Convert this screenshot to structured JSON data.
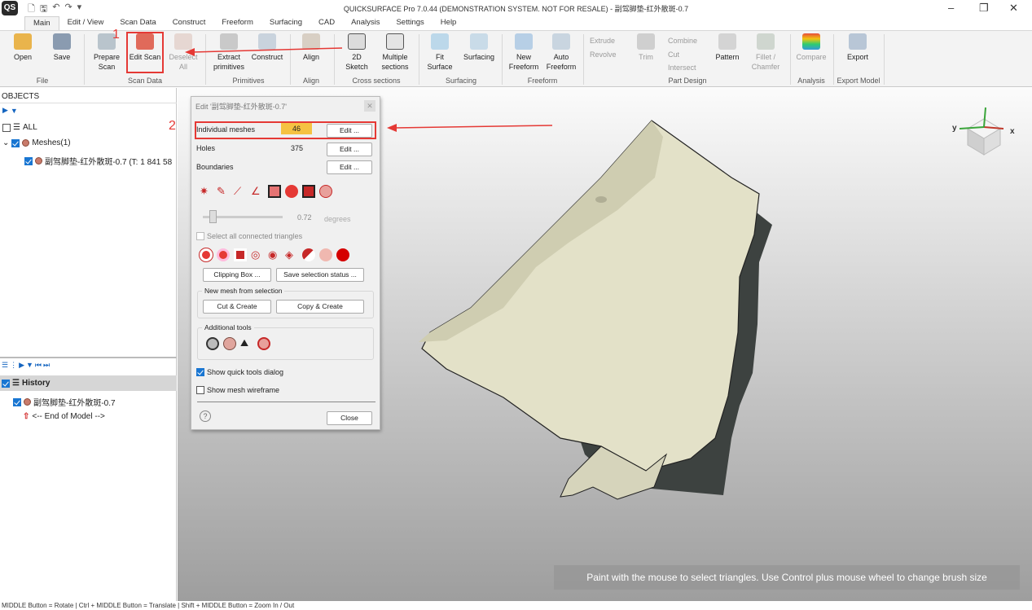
{
  "window": {
    "title": "QUICKSURFACE Pro 7.0.44 (DEMONSTRATION SYSTEM. NOT FOR RESALE) - 副驾脚垫-红外散斑-0.7",
    "logo": "QS",
    "minimize": "–",
    "restore": "❐",
    "close": "✕"
  },
  "menu": [
    "Main",
    "Edit / View",
    "Scan Data",
    "Construct",
    "Freeform",
    "Surfacing",
    "CAD",
    "Analysis",
    "Settings",
    "Help"
  ],
  "ribbon": {
    "open": "Open",
    "save": "Save",
    "file_group": "File",
    "prepare_scan": "Prepare Scan",
    "edit_scan": "Edit Scan",
    "deselect_all": "Deselect All",
    "scan_group": "Scan Data",
    "extract_primitives": "Extract primitives",
    "construct": "Construct",
    "primitives_group": "Primitives",
    "align": "Align",
    "align_group": "Align",
    "sketch_2d": "2D Sketch",
    "multiple_sections": "Multiple sections",
    "cross_group": "Cross sections",
    "fit_surface": "Fit Surface",
    "surfacing": "Surfacing",
    "surfacing_group": "Surfacing",
    "new_freeform": "New Freeform",
    "auto_freeform": "Auto Freeform",
    "freeform_group": "Freeform",
    "extrude": "Extrude",
    "revolve": "Revolve",
    "trim": "Trim",
    "combine": "Combine",
    "cut": "Cut",
    "intersect": "Intersect",
    "pattern": "Pattern",
    "fillet_chamfer": "Fillet / Chamfer",
    "part_group": "Part Design",
    "compare": "Compare",
    "analysis_group": "Analysis",
    "export": "Export",
    "export_group": "Export Model"
  },
  "objects": {
    "header": "OBJECTS",
    "all": "ALL",
    "meshes": "Meshes(1)",
    "mesh_item": "副驾脚垫-红外散斑-0.7 (T: 1 841 58"
  },
  "history": {
    "header": "History",
    "item": "副驾脚垫-红外散斑-0.7",
    "end": "<-- End of Model -->"
  },
  "dialog": {
    "title": "Edit '副驾脚垫-红外散斑-0.7'",
    "individual_meshes": "Individual meshes",
    "individual_count": "46",
    "holes": "Holes",
    "holes_count": "375",
    "boundaries": "Boundaries",
    "edit_btn": "Edit ...",
    "slider_value": "0.72",
    "slider_unit": "degrees",
    "select_connected": "Select all connected triangles",
    "clipping_box": "Clipping Box ...",
    "save_selection": "Save selection status ...",
    "new_mesh_group": "New mesh from selection",
    "cut_create": "Cut & Create",
    "copy_create": "Copy & Create",
    "additional_tools": "Additional tools",
    "show_quick_tools": "Show quick tools dialog",
    "show_wireframe": "Show mesh wireframe",
    "help": "?",
    "close": "Close"
  },
  "annotations": {
    "step1": "1",
    "step2": "2"
  },
  "viewport": {
    "hint": "Paint with the mouse to select triangles. Use Control plus mouse wheel to change brush size",
    "axis_x": "x",
    "axis_y": "y"
  },
  "status": "MIDDLE Button = Rotate | Ctrl + MIDDLE Button = Translate | Shift + MIDDLE Button = Zoom In / Out",
  "colors": {
    "accent": "#e53935",
    "mesh": "#e3e1c8",
    "mesh_shadow": "#3a3f3c",
    "badge": "#f5c242"
  }
}
